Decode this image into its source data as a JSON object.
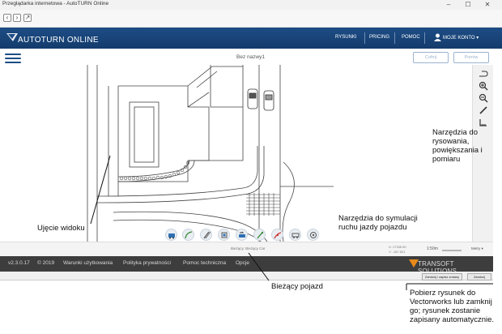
{
  "window": {
    "title": "Przeglądarka internetowa - AutoTURN Online"
  },
  "app": {
    "name": "AUTOTURN ONLINE"
  },
  "menu": {
    "drawings": "RYSUNKI",
    "pricing": "PRICING",
    "help": "POMOC",
    "account": "MOJE KONTO"
  },
  "document": {
    "title": "Bez nazwy1"
  },
  "toolbar": {
    "undo": "Cofnij",
    "redo": "Ponów"
  },
  "status": {
    "current_vehicle": "Bieżący: Bieżący Car",
    "coord_x": "X: 17335.90",
    "coord_y": "Y: -187.521",
    "scale": "1:50m",
    "units": "Metry"
  },
  "footer": {
    "version": "v2.3.0.17",
    "copyright": "© 2019",
    "terms": "Warunki użytkowania",
    "privacy": "Polityka prywatności",
    "support": "Pomoc techniczna",
    "options": "Opcje",
    "brand": "TRANSOFT SOLUTIONS"
  },
  "actions": {
    "close_save": "Zamknij i zapisz zmiany",
    "close": "Zamknij"
  },
  "callouts": {
    "tools": "Narzędzia do rysowania, powiększania i pomiaru",
    "viewport": "Ujęcie widoku",
    "simulation": "Narzędzia do symulacji ruchu jazdy pojazdu",
    "current_vehicle": "Bieżący pojazd",
    "send": "Pobierz rysunek do Vectorworks lub zamknij go; rysunek zostanie zapisany automatycznie."
  },
  "colors": {
    "header": "#1d4d86",
    "footer": "#3d3d3d",
    "accent": "#e88a1a"
  },
  "icons": {
    "right_tools": [
      "path-icon",
      "zoom-in-icon",
      "zoom-out-icon",
      "draw-icon",
      "measure-icon"
    ],
    "vehicle_tools": [
      "vehicle-icon",
      "arc-steer-icon",
      "straight-steer-icon",
      "park-icon",
      "reverse-icon",
      "turn-icon",
      "edit-path-icon",
      "vehicle-settings-icon",
      "profile-icon"
    ]
  }
}
